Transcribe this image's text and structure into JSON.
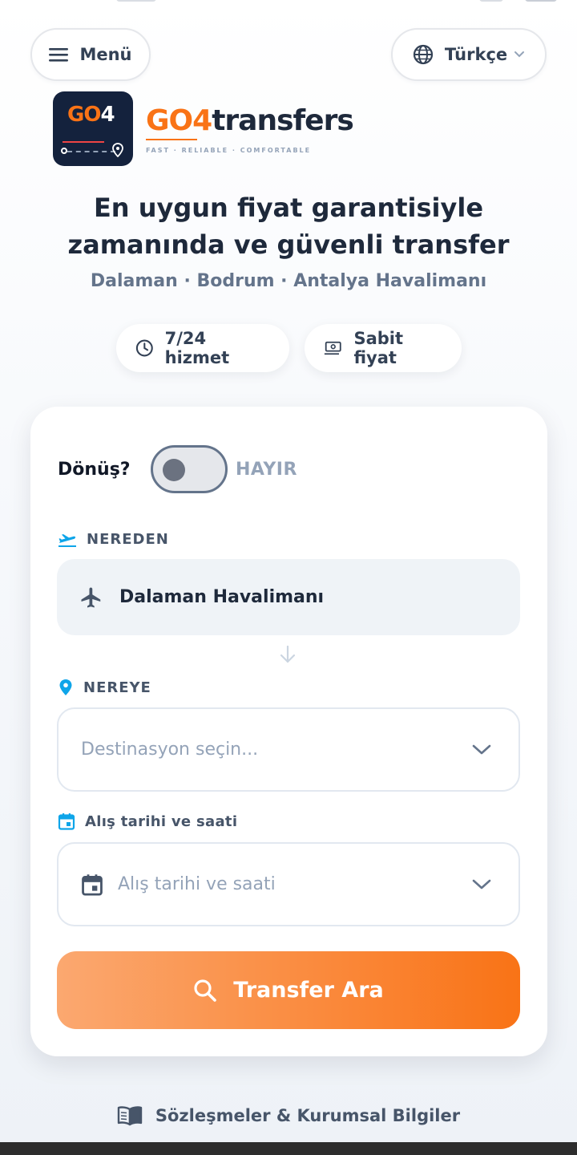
{
  "header": {
    "menu_label": "Menü",
    "language_label": "Türkçe"
  },
  "brand": {
    "logo_go": "GO",
    "logo_four": "4",
    "name_go": "GO4",
    "name_rest": "transfers",
    "tagline": "FAST · RELIABLE · COMFORTABLE"
  },
  "hero": {
    "headline_line1": "En uygun fiyat garantisiyle",
    "headline_line2": "zamanında ve güvenli transfer",
    "subline": "Dalaman · Bodrum · Antalya Havalimanı"
  },
  "badges": [
    {
      "label": "7/24 hizmet",
      "icon": "clock-icon"
    },
    {
      "label": "Sabit fiyat",
      "icon": "cash-icon"
    }
  ],
  "form": {
    "return_label": "Dönüş?",
    "return_toggle_state": "HAYIR",
    "return_enabled": false,
    "from_label": "NEREDEN",
    "from_value": "Dalaman Havalimanı",
    "to_label": "NEREYE",
    "to_placeholder": "Destinasyon seçin...",
    "date_label": "Alış tarihi ve saati",
    "date_placeholder": "Alış tarihi ve saati",
    "search_button": "Transfer Ara"
  },
  "footer": {
    "link_label": "Sözleşmeler & Kurumsal Bilgiler"
  },
  "colors": {
    "accent": "#f97316",
    "brand_dark": "#14223d",
    "airport_icon": "#0ea5e9"
  }
}
